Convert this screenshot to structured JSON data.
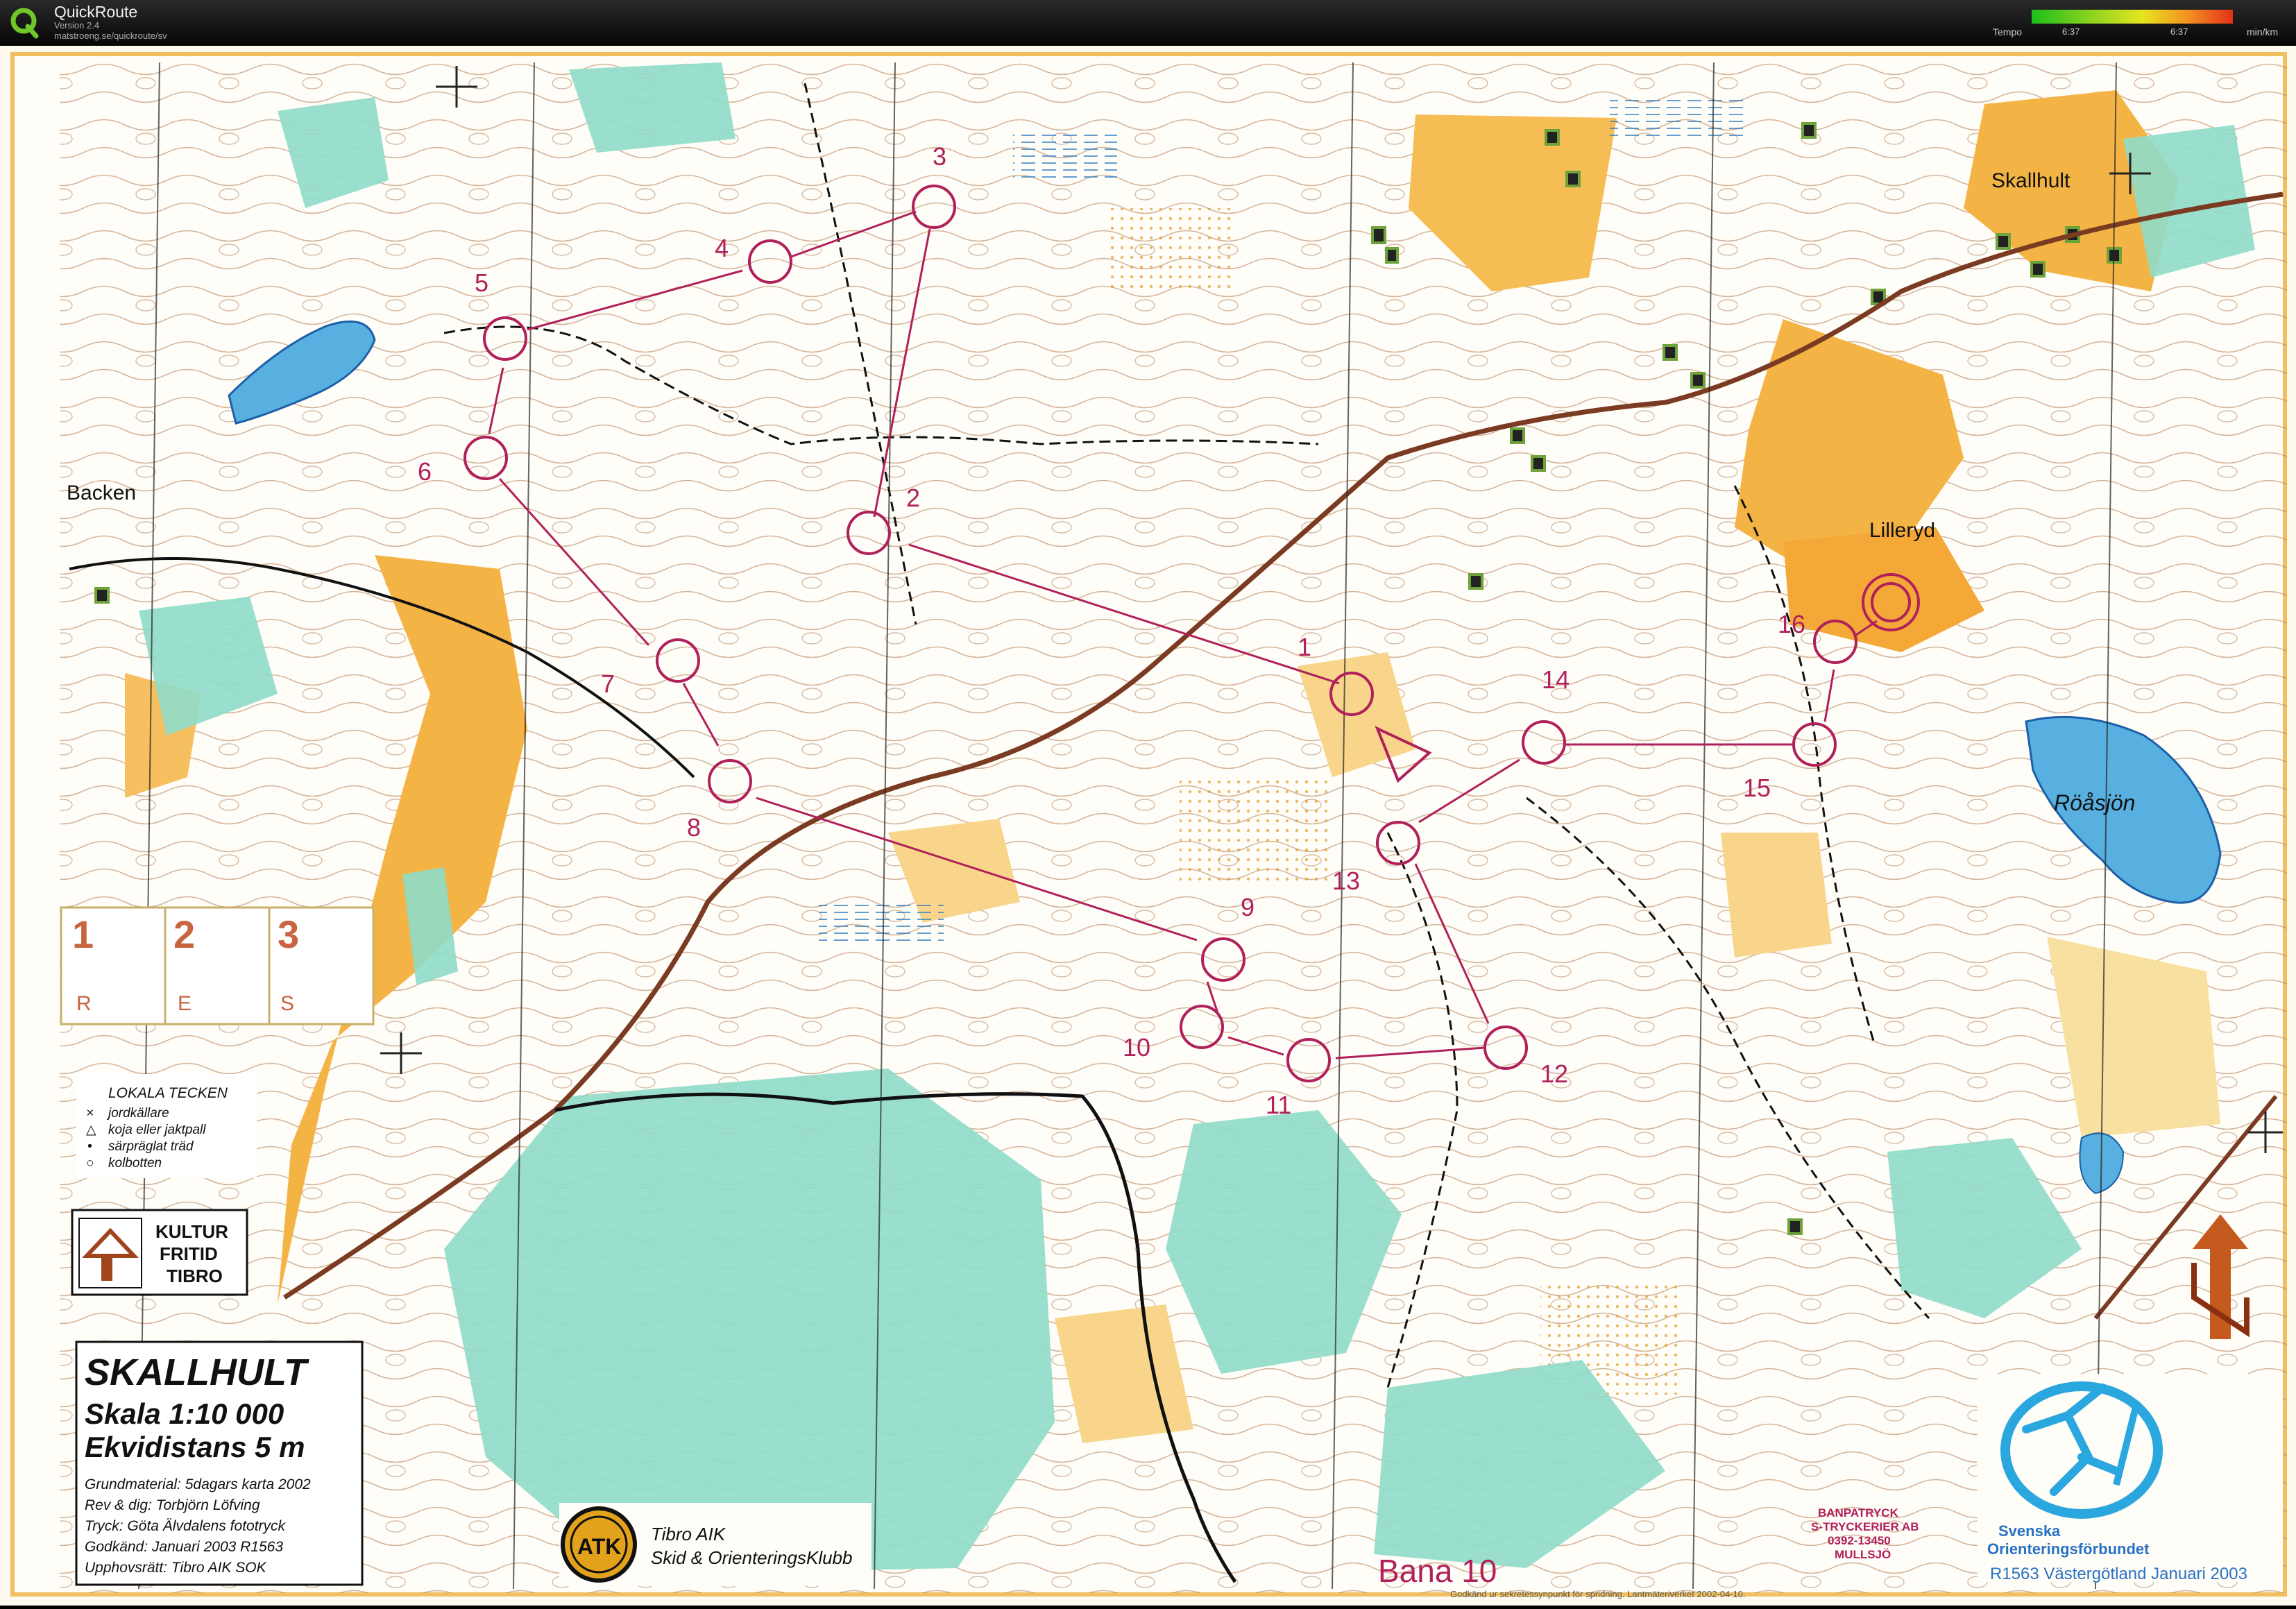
{
  "app": {
    "title": "QuickRoute",
    "version": "Version 2.4",
    "url": "matstroeng.se/quickroute/sv",
    "logo_icon": "quickroute-q-logo"
  },
  "tempo": {
    "label": "Tempo",
    "tick_1": "6:37",
    "tick_2": "6:37",
    "unit": "min/km"
  },
  "map": {
    "place_names": {
      "backen": "Backen",
      "skallhult": "Skallhult",
      "lilleryd": "Lilleryd",
      "roasjon": "Röåsjön"
    },
    "controls": [
      {
        "label": "1"
      },
      {
        "label": "2"
      },
      {
        "label": "3"
      },
      {
        "label": "4"
      },
      {
        "label": "5"
      },
      {
        "label": "6"
      },
      {
        "label": "7"
      },
      {
        "label": "8"
      },
      {
        "label": "9"
      },
      {
        "label": "10"
      },
      {
        "label": "11"
      },
      {
        "label": "12"
      },
      {
        "label": "13"
      },
      {
        "label": "14"
      },
      {
        "label": "15"
      },
      {
        "label": "16"
      }
    ],
    "res_box": {
      "numbers": [
        "1",
        "2",
        "3"
      ],
      "letters": [
        "R",
        "E",
        "S"
      ]
    },
    "legend": {
      "title": "LOKALA TECKEN",
      "items": [
        "jordkällare",
        "koja eller jaktpall",
        "särpräglat träd",
        "kolbotten"
      ],
      "symbols": [
        "×",
        "△",
        "•",
        "○"
      ]
    },
    "kultur_logo": {
      "line1": "KULTUR",
      "line2": "FRITID",
      "line3": "TIBRO"
    },
    "title_block": {
      "title": "SKALLHULT",
      "scale": "Skala  1:10 000",
      "contour": "Ekvidistans 5 m",
      "credits": [
        "Grundmaterial: 5dagars karta 2002",
        "Rev & dig: Torbjörn Löfving",
        "Tryck: Göta Älvdalens fototryck",
        "Godkänd: Januari 2003 R1563",
        "Upphovsrätt: Tibro AIK SOK"
      ]
    },
    "club": {
      "badge": "ATK",
      "line1": "Tibro AIK",
      "line2": "Skid & OrienteringsKlubb"
    },
    "course_label": "Bana 10",
    "printer": {
      "line1": "BANPATRYCK",
      "line2": "S-TRYCKERIER AB",
      "line3": "0392-13450",
      "line4": "MULLSJÖ"
    },
    "footer_note": "Godkänd ur sekretessynpunkt för spridning. Lantmäteriverket 2002-04-10.",
    "sof": {
      "line1": "Svenska",
      "line2": "Orienteringsförbundet",
      "approval": "R1563  Västergötland Januari 2003"
    }
  },
  "colors": {
    "course": "#b0205a",
    "open_land": "#f4b445",
    "forest_green": "#7fd6c4",
    "water": "#58b0e0",
    "road": "#7a3b22",
    "contour": "#a0653a"
  }
}
